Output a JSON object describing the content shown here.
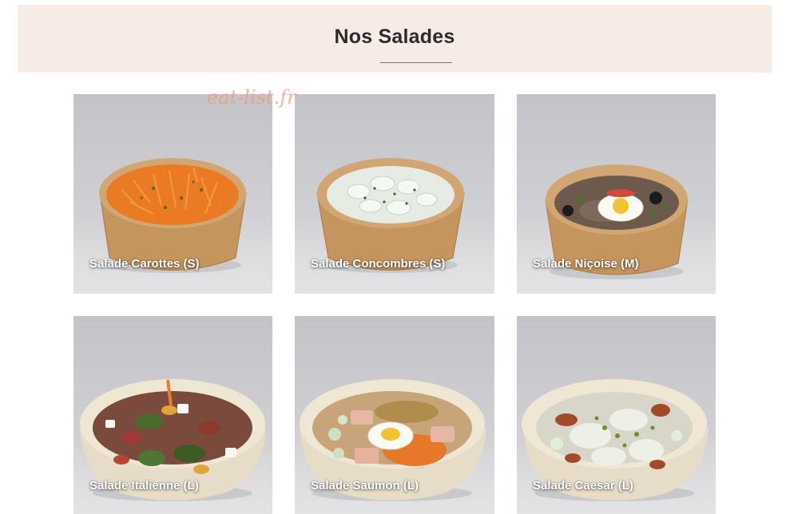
{
  "header": {
    "title": "Nos Salades"
  },
  "watermark": "eat-list.fr",
  "salads": [
    {
      "label": "Salade Carottes (S)",
      "icon": "carrot-salad-image"
    },
    {
      "label": "Salade Concombres (S)",
      "icon": "cucumber-salad-image"
    },
    {
      "label": "Salade Niçoise (M)",
      "icon": "nicoise-salad-image"
    },
    {
      "label": "Salade Italienne (L)",
      "icon": "italian-salad-image"
    },
    {
      "label": "Salade Saumon (L)",
      "icon": "salmon-salad-image"
    },
    {
      "label": "Salade Caesar (L)",
      "icon": "caesar-salad-image"
    }
  ],
  "colors": {
    "banner_bg": "#f7ebe6",
    "kraft_bowl": "#c79a62",
    "bagasse_bowl": "#e7dcc7"
  }
}
